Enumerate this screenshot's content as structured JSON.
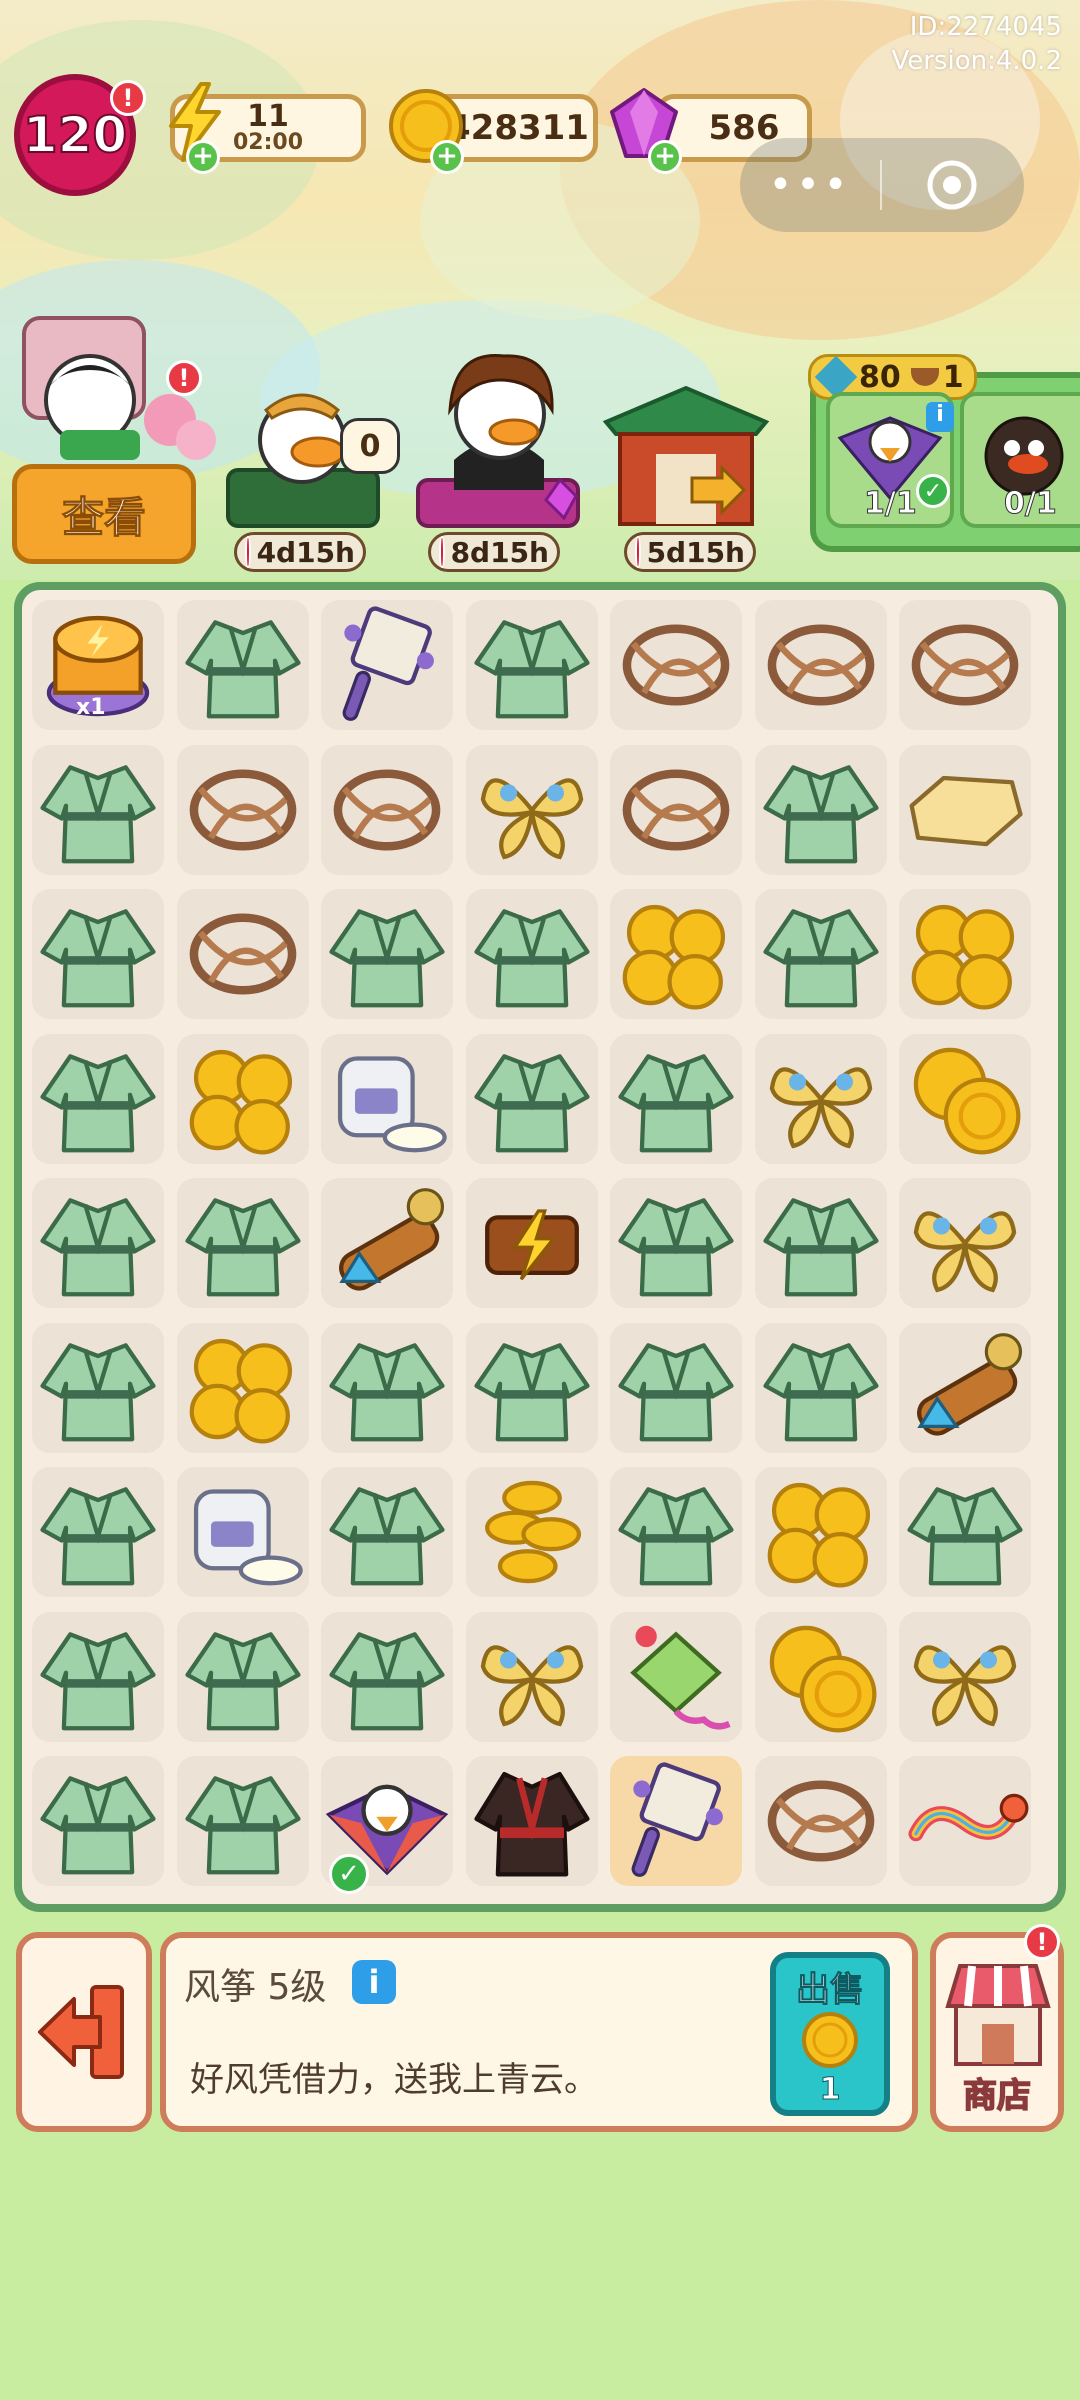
{
  "header": {
    "id_text": "ID:2274045",
    "version_text": "Version:4.0.2",
    "level": "120",
    "energy": {
      "value": "11",
      "timer": "02:00"
    },
    "coins": "428311",
    "gems": "586"
  },
  "customers": {
    "view_button": "查看",
    "bubble_count": "0",
    "timers": [
      "4d15h",
      "8d15h",
      "5d15h"
    ]
  },
  "order": {
    "requirement_count": "80",
    "requirement_second": "1",
    "slots": [
      {
        "progress": "1/1",
        "done": true
      },
      {
        "progress": "0/1",
        "done": false
      }
    ]
  },
  "board": {
    "rows": [
      [
        "energy-chest",
        "robe",
        "fan",
        "robe",
        "twig",
        "twig",
        "twig"
      ],
      [
        "robe",
        "twig",
        "twig",
        "butterfly",
        "twig",
        "robe",
        "paper"
      ],
      [
        "robe",
        "twig",
        "robe",
        "robe",
        "coins-pile",
        "robe",
        "coins-pile"
      ],
      [
        "robe",
        "coins-pile",
        "cream-jar",
        "robe",
        "robe",
        "butterfly",
        "coins-two"
      ],
      [
        "robe",
        "robe",
        "kaleidoscope",
        "energy-box",
        "robe",
        "robe",
        "butterfly"
      ],
      [
        "robe",
        "coins-pile",
        "robe",
        "robe",
        "robe",
        "robe",
        "kaleidoscope"
      ],
      [
        "robe",
        "cream-jar",
        "robe",
        "coins-stack",
        "robe",
        "coins-pile",
        "robe"
      ],
      [
        "robe",
        "robe",
        "robe",
        "butterfly",
        "kite-green",
        "coins-two",
        "butterfly"
      ],
      [
        "robe",
        "robe",
        "kite-bird",
        "dark-robe",
        "fan",
        "twig",
        "rainbow-dragon"
      ]
    ],
    "energy_chest_label": "x1",
    "selected": {
      "row": 8,
      "col": 4
    },
    "checked": {
      "row": 8,
      "col": 2
    }
  },
  "info_panel": {
    "title": "风筝 5级",
    "description": "好风凭借力，送我上青云。",
    "sell_label": "出售",
    "sell_price": "1",
    "shop_label": "商店"
  },
  "colors": {
    "board_border": "#5f9e62",
    "background": "#c8eda0",
    "robe": "#9fd2a8",
    "coin": "#f3b617"
  }
}
